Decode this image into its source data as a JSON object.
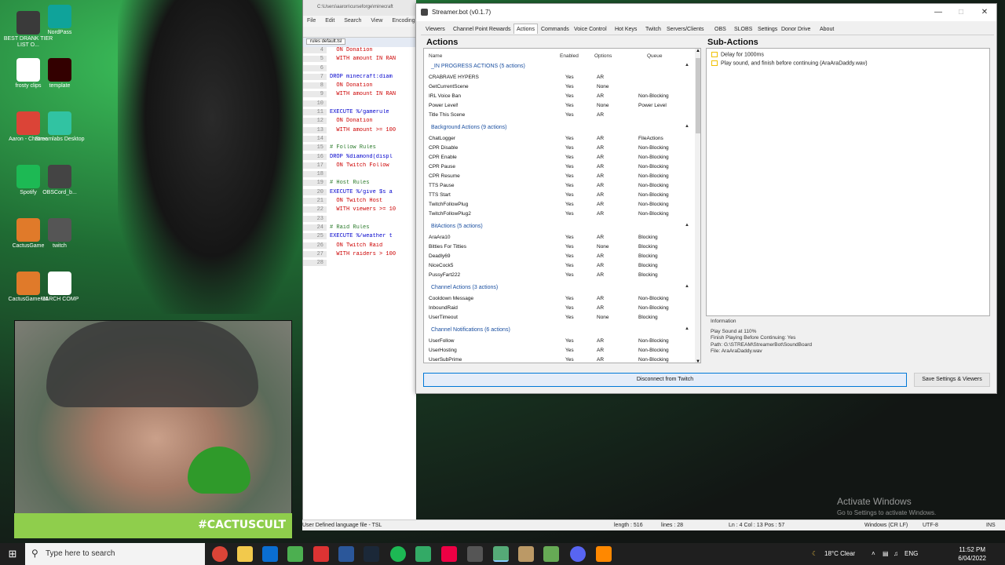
{
  "desktop": {
    "icons": [
      {
        "label": "BEST DRANK TIER LIST O...",
        "color": "#3a3a3a"
      },
      {
        "label": "NordPass",
        "color": "#0fa39a"
      },
      {
        "label": "frosty clips",
        "color": "#ffffff"
      },
      {
        "label": "template",
        "color": "#330000"
      },
      {
        "label": "Aaron - Chrome",
        "color": "#db4437"
      },
      {
        "label": "Streamlabs Desktop",
        "color": "#31c3a2"
      },
      {
        "label": "Spotify",
        "color": "#1db954"
      },
      {
        "label": "OBSCord_b...",
        "color": "#444444"
      },
      {
        "label": "CactusGame",
        "color": "#e07a2a"
      },
      {
        "label": "twitch",
        "color": "#555555"
      },
      {
        "label": "CactusGame-36",
        "color": "#e07a2a"
      },
      {
        "label": "MARCH COMP",
        "color": "#ffffff"
      }
    ],
    "banner_text": "#CACTUSCULT",
    "watermark_title": "Activate Windows",
    "watermark_sub": "Go to Settings to activate Windows."
  },
  "npp": {
    "title": "C:\\Users\\aaron\\curseforge\\minecraft",
    "menu": [
      "File",
      "Edit",
      "Search",
      "View",
      "Encoding"
    ],
    "tab": "rules default.tsl",
    "lines": [
      {
        "n": "4",
        "t": "  ON Donation"
      },
      {
        "n": "5",
        "t": "  WITH amount IN RAN"
      },
      {
        "n": "6",
        "t": ""
      },
      {
        "n": "7",
        "t": "DROP minecraft:diam"
      },
      {
        "n": "8",
        "t": "  ON Donation"
      },
      {
        "n": "9",
        "t": "  WITH amount IN RAN"
      },
      {
        "n": "10",
        "t": ""
      },
      {
        "n": "11",
        "t": "EXECUTE %/gamerule"
      },
      {
        "n": "12",
        "t": "  ON Donation"
      },
      {
        "n": "13",
        "t": "  WITH amount >= 100"
      },
      {
        "n": "14",
        "t": ""
      },
      {
        "n": "15",
        "t": "# Follow Rules"
      },
      {
        "n": "16",
        "t": "DROP %diamond(displ"
      },
      {
        "n": "17",
        "t": "  ON Twitch Follow"
      },
      {
        "n": "18",
        "t": ""
      },
      {
        "n": "19",
        "t": "# Host Rules"
      },
      {
        "n": "20",
        "t": "EXECUTE %/give $s a"
      },
      {
        "n": "21",
        "t": "  ON Twitch Host"
      },
      {
        "n": "22",
        "t": "  WITH viewers >= 10"
      },
      {
        "n": "23",
        "t": ""
      },
      {
        "n": "24",
        "t": "# Raid Rules"
      },
      {
        "n": "25",
        "t": "EXECUTE %/weather t"
      },
      {
        "n": "26",
        "t": "  ON Twitch Raid"
      },
      {
        "n": "27",
        "t": "  WITH raiders > 100"
      },
      {
        "n": "28",
        "t": ""
      }
    ],
    "status": {
      "lang": "User Defined language file - TSL",
      "length": "length : 516",
      "lines": "lines : 28",
      "pos": "Ln : 4   Col : 13   Pos : 57",
      "eol": "Windows (CR LF)",
      "enc": "UTF-8",
      "ins": "INS"
    }
  },
  "sb": {
    "title": "Streamer.bot (v0.1.7)",
    "tabs": [
      "Viewers",
      "Channel Point Rewards",
      "Actions",
      "Commands",
      "Voice Control",
      "Hot Keys",
      "Twitch",
      "Servers/Clients",
      "OBS",
      "SLOBS",
      "Settings",
      "Donor Drive",
      "About"
    ],
    "active_tab": "Actions",
    "actions_title": "Actions",
    "subactions_title": "Sub-Actions",
    "columns": {
      "name": "Name",
      "enabled": "Enabled",
      "options": "Options",
      "queue": "Queue"
    },
    "groups": [
      {
        "label": "_IN PROGRESS ACTIONS (5 actions)",
        "rows": [
          {
            "name": "CRABRAVE HYPERS",
            "enabled": "Yes",
            "options": "AR",
            "queue": ""
          },
          {
            "name": "GetCurrentScene",
            "enabled": "Yes",
            "options": "None",
            "queue": ""
          },
          {
            "name": "IRL Voice Ban",
            "enabled": "Yes",
            "options": "AR",
            "queue": "Non-Blocking"
          },
          {
            "name": "Power Level!",
            "enabled": "Yes",
            "options": "None",
            "queue": "Power Level"
          },
          {
            "name": "Title This Scene",
            "enabled": "Yes",
            "options": "AR",
            "queue": ""
          }
        ]
      },
      {
        "label": "Background Actions (9 actions)",
        "rows": [
          {
            "name": "ChatLogger",
            "enabled": "Yes",
            "options": "AR",
            "queue": "FileActions"
          },
          {
            "name": "CPR Disable",
            "enabled": "Yes",
            "options": "AR",
            "queue": "Non-Blocking"
          },
          {
            "name": "CPR Enable",
            "enabled": "Yes",
            "options": "AR",
            "queue": "Non-Blocking"
          },
          {
            "name": "CPR Pause",
            "enabled": "Yes",
            "options": "AR",
            "queue": "Non-Blocking"
          },
          {
            "name": "CPR Resume",
            "enabled": "Yes",
            "options": "AR",
            "queue": "Non-Blocking"
          },
          {
            "name": "TTS Pause",
            "enabled": "Yes",
            "options": "AR",
            "queue": "Non-Blocking"
          },
          {
            "name": "TTS Start",
            "enabled": "Yes",
            "options": "AR",
            "queue": "Non-Blocking"
          },
          {
            "name": "TwitchFollowPlug",
            "enabled": "Yes",
            "options": "AR",
            "queue": "Non-Blocking"
          },
          {
            "name": "TwitchFollowPlug2",
            "enabled": "Yes",
            "options": "AR",
            "queue": "Non-Blocking"
          }
        ]
      },
      {
        "label": "BitActions (5 actions)",
        "rows": [
          {
            "name": "AraAra10",
            "enabled": "Yes",
            "options": "AR",
            "queue": "Blocking"
          },
          {
            "name": "Bitties For Titties",
            "enabled": "Yes",
            "options": "None",
            "queue": "Blocking"
          },
          {
            "name": "Deadly69",
            "enabled": "Yes",
            "options": "AR",
            "queue": "Blocking"
          },
          {
            "name": "NiceCock5",
            "enabled": "Yes",
            "options": "AR",
            "queue": "Blocking"
          },
          {
            "name": "PussyFart222",
            "enabled": "Yes",
            "options": "AR",
            "queue": "Blocking"
          }
        ]
      },
      {
        "label": "Channel Actions (3 actions)",
        "rows": [
          {
            "name": "Cooldown Message",
            "enabled": "Yes",
            "options": "AR",
            "queue": "Non-Blocking"
          },
          {
            "name": "InboundRaid",
            "enabled": "Yes",
            "options": "AR",
            "queue": "Non-Blocking"
          },
          {
            "name": "UserTimeout",
            "enabled": "Yes",
            "options": "None",
            "queue": "Blocking"
          }
        ]
      },
      {
        "label": "Channel Notifications (6 actions)",
        "rows": [
          {
            "name": "UserFollow",
            "enabled": "Yes",
            "options": "AR",
            "queue": "Non-Blocking"
          },
          {
            "name": "UserHosting",
            "enabled": "Yes",
            "options": "AR",
            "queue": "Non-Blocking"
          },
          {
            "name": "UserSubPrime",
            "enabled": "Yes",
            "options": "AR",
            "queue": "Non-Blocking"
          },
          {
            "name": "UserSub1",
            "enabled": "Yes",
            "options": "AR",
            "queue": "Non-Blocking"
          }
        ]
      }
    ],
    "subactions": [
      "Delay for 1000ms",
      "Play sound, and finish before continuing (AraAraDaddy.wav)"
    ],
    "info": {
      "title": "Information",
      "lines": [
        "Play Sound at 110%",
        "Finish Playing Before Continuing: Yes",
        "Path: G:\\STREAM\\StreamerBot\\SoundBoard",
        "File: AraAraDaddy.wav"
      ]
    },
    "disconnect_label": "Disconnect from Twitch",
    "save_label": "Save Settings & Viewers"
  },
  "taskbar": {
    "search_placeholder": "Type here to search",
    "weather": "18°C  Clear",
    "lang": "ENG",
    "time": "11:52 PM",
    "date": "6/04/2022"
  }
}
